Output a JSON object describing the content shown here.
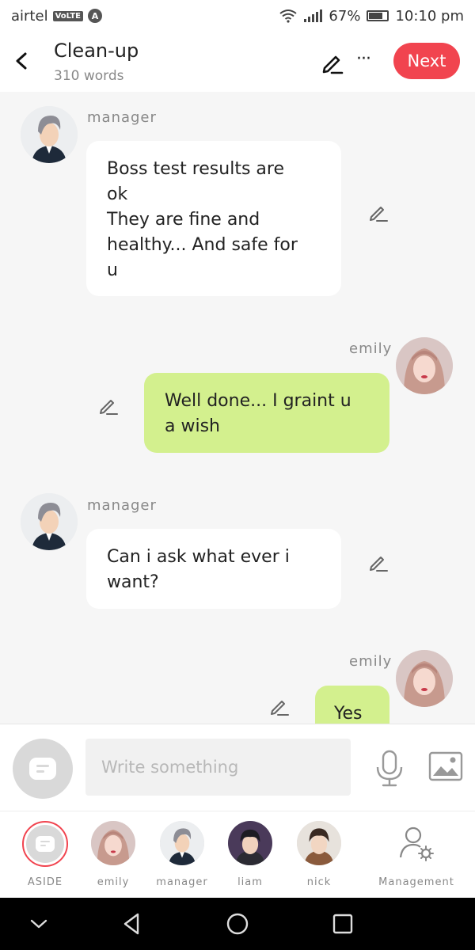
{
  "status_bar": {
    "carrier": "airtel",
    "volte": "VoLTE",
    "network_icon": "A",
    "battery_percent": "67%",
    "battery_level": 0.67,
    "time": "10:10 pm"
  },
  "header": {
    "title": "Clean-up",
    "word_count": "310 words",
    "more_label": "···",
    "next_label": "Next"
  },
  "messages": [
    {
      "sender": "manager",
      "side": "left",
      "text_lines": [
        "Boss test  results are",
        "ok",
        "They are fine and",
        "healthy... And safe for",
        "u"
      ]
    },
    {
      "sender": "emily",
      "side": "right",
      "text_lines": [
        "Well done... I graint u",
        "a wish"
      ]
    },
    {
      "sender": "manager",
      "side": "left",
      "text_lines": [
        "Can i ask what  ever i",
        "want?"
      ]
    },
    {
      "sender": "emily",
      "side": "right",
      "text_lines": [
        "Yes"
      ]
    }
  ],
  "input": {
    "placeholder": "Write something"
  },
  "characters": [
    {
      "label": "ASIDE"
    },
    {
      "label": "emily"
    },
    {
      "label": "manager"
    },
    {
      "label": "liam"
    },
    {
      "label": "nick"
    },
    {
      "label": "Management"
    }
  ],
  "colors": {
    "accent": "#f1444f",
    "bubble_green": "#d3f08e",
    "bubble_white": "#ffffff",
    "background": "#f6f6f6"
  },
  "icons": [
    "back-arrow-icon",
    "pencil-icon",
    "more-icon",
    "chat-icon",
    "microphone-icon",
    "image-icon",
    "management-icon",
    "nav-down-icon",
    "nav-back-icon",
    "nav-home-icon",
    "nav-recents-icon"
  ]
}
